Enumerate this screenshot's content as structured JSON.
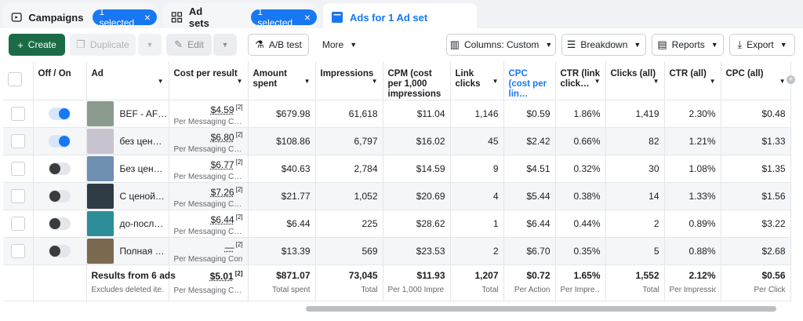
{
  "tabs": [
    {
      "label": "Campaigns",
      "icon": "folder-icon",
      "pill": "1 selected"
    },
    {
      "label": "Ad sets",
      "icon": "grid-icon",
      "pill": "1 selected"
    },
    {
      "label": "Ads for 1 Ad set",
      "icon": "ad-icon"
    }
  ],
  "toolbar": {
    "create": "Create",
    "duplicate": "Duplicate",
    "edit": "Edit",
    "ab_test": "A/B test",
    "more": "More",
    "columns": "Columns: Custom",
    "breakdown": "Breakdown",
    "reports": "Reports",
    "export": "Export"
  },
  "colors": {
    "accent": "#1877f2",
    "create": "#1a6b46"
  },
  "columns": [
    "Off / On",
    "Ad",
    "Cost per result",
    "Amount spent",
    "Impressions",
    "CPM (cost per 1,000 impressions",
    "Link clicks",
    "CPC (cost per lin…",
    "CTR (link click…",
    "Clicks (all)",
    "CTR (all)",
    "CPC (all)"
  ],
  "rows": [
    {
      "on": true,
      "name": "BEF - AF…",
      "cost": "$4.59",
      "cost_sub": "Per Messaging C…",
      "spent": "$679.98",
      "impr": "61,618",
      "cpm": "$11.04",
      "link": "1,146",
      "cpc": "$0.59",
      "ctr": "1.86%",
      "clicks": "1,419",
      "ctr_all": "2.30%",
      "cpc_all": "$0.48"
    },
    {
      "on": true,
      "name": "без цен…",
      "cost": "$6.80",
      "cost_sub": "Per Messaging C…",
      "spent": "$108.86",
      "impr": "6,797",
      "cpm": "$16.02",
      "link": "45",
      "cpc": "$2.42",
      "ctr": "0.66%",
      "clicks": "82",
      "ctr_all": "1.21%",
      "cpc_all": "$1.33"
    },
    {
      "on": false,
      "name": "Без цен…",
      "cost": "$6.77",
      "cost_sub": "Per Messaging C…",
      "spent": "$40.63",
      "impr": "2,784",
      "cpm": "$14.59",
      "link": "9",
      "cpc": "$4.51",
      "ctr": "0.32%",
      "clicks": "30",
      "ctr_all": "1.08%",
      "cpc_all": "$1.35"
    },
    {
      "on": false,
      "name": "С ценой…",
      "cost": "$7.26",
      "cost_sub": "Per Messaging C…",
      "spent": "$21.77",
      "impr": "1,052",
      "cpm": "$20.69",
      "link": "4",
      "cpc": "$5.44",
      "ctr": "0.38%",
      "clicks": "14",
      "ctr_all": "1.33%",
      "cpc_all": "$1.56"
    },
    {
      "on": false,
      "name": "до-посл…",
      "cost": "$6.44",
      "cost_sub": "Per Messaging C…",
      "spent": "$6.44",
      "impr": "225",
      "cpm": "$28.62",
      "link": "1",
      "cpc": "$6.44",
      "ctr": "0.44%",
      "clicks": "2",
      "ctr_all": "0.89%",
      "cpc_all": "$3.22"
    },
    {
      "on": false,
      "name": "Полная …",
      "cost": "—",
      "cost_sub": "Per Messaging Con…",
      "spent": "$13.39",
      "impr": "569",
      "cpm": "$23.53",
      "link": "2",
      "cpc": "$6.70",
      "ctr": "0.35%",
      "clicks": "5",
      "ctr_all": "0.88%",
      "cpc_all": "$2.68"
    }
  ],
  "footnote_mark": "[2]",
  "summary": {
    "label": "Results from 6 ads",
    "label_sub": "Excludes deleted ite…",
    "cost": "$5.01",
    "cost_sub": "Per Messaging C…",
    "spent": "$871.07",
    "spent_sub": "Total spent",
    "impr": "73,045",
    "impr_sub": "Total",
    "cpm": "$11.93",
    "cpm_sub": "Per 1,000 Impre…",
    "link": "1,207",
    "link_sub": "Total",
    "cpc": "$0.72",
    "cpc_sub": "Per Action",
    "ctr": "1.65%",
    "ctr_sub": "Per Impre…",
    "clicks": "1,552",
    "clicks_sub": "Total",
    "ctr_all": "2.12%",
    "ctr_all_sub": "Per Impressio…",
    "cpc_all": "$0.56",
    "cpc_all_sub": "Per Click"
  }
}
